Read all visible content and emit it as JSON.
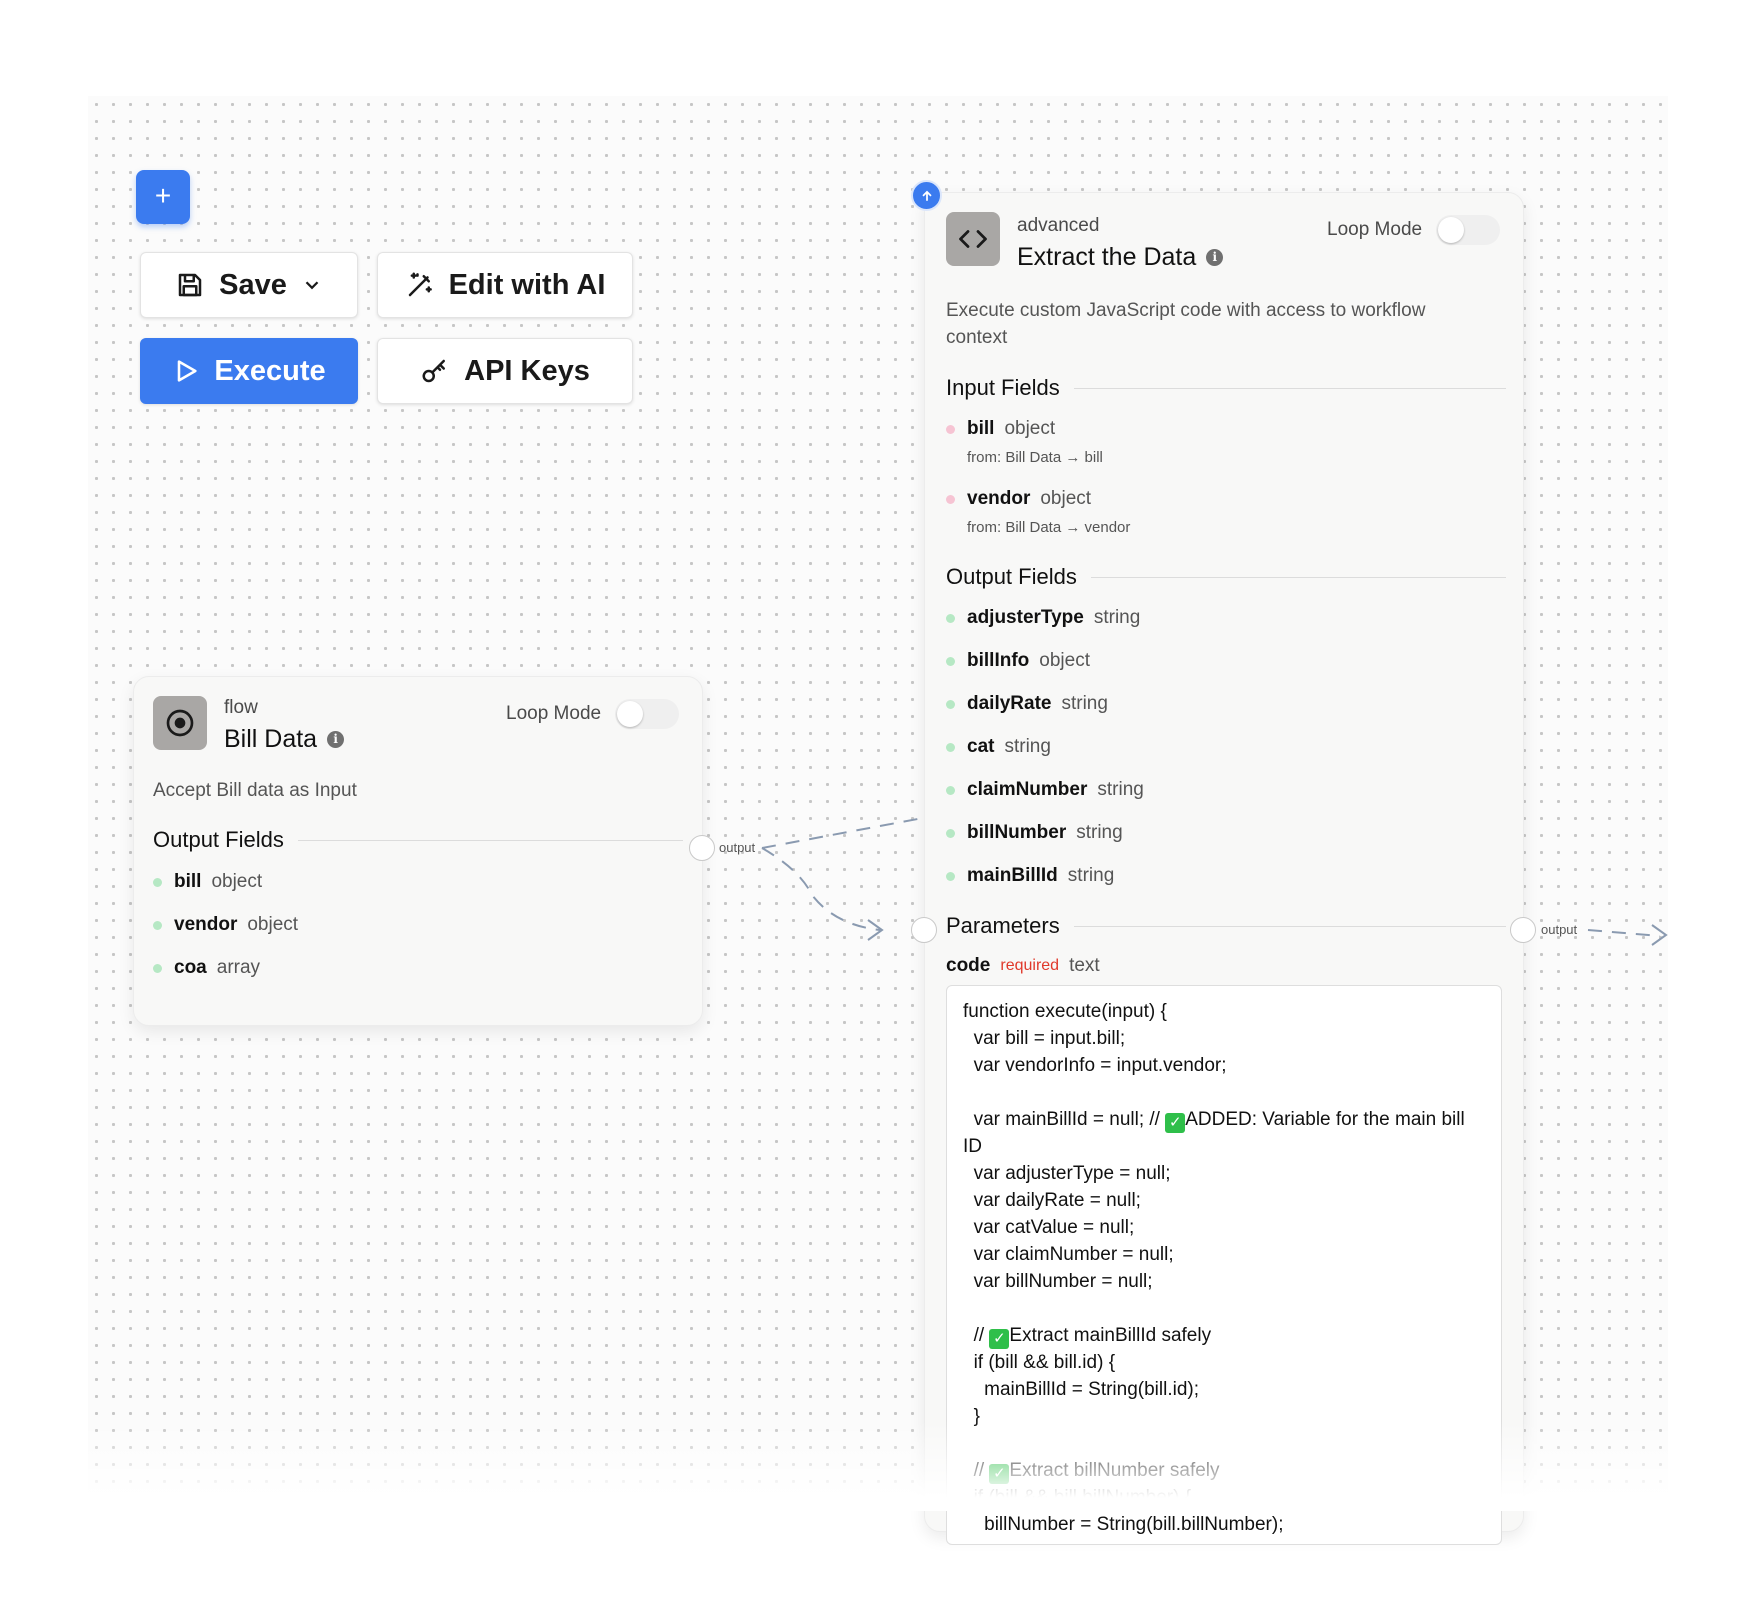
{
  "toolbar": {
    "add_label": "+",
    "save_label": "Save",
    "edit_ai_label": "Edit with AI",
    "execute_label": "Execute",
    "api_keys_label": "API Keys",
    "accent_color": "#3b7bef"
  },
  "bill_node": {
    "category": "flow",
    "title": "Bill Data",
    "info_icon": "i",
    "loop_mode_label": "Loop Mode",
    "loop_mode_on": false,
    "description": "Accept Bill data as Input",
    "output_section_title": "Output Fields",
    "outputs": [
      {
        "name": "bill",
        "type": "object"
      },
      {
        "name": "vendor",
        "type": "object"
      },
      {
        "name": "coa",
        "type": "array"
      }
    ],
    "output_port_label": "output"
  },
  "extract_node": {
    "category": "advanced",
    "title": "Extract the Data",
    "info_icon": "i",
    "loop_mode_label": "Loop Mode",
    "loop_mode_on": false,
    "description": "Execute custom JavaScript code with access to workflow context",
    "input_section_title": "Input Fields",
    "inputs": [
      {
        "name": "bill",
        "type": "object",
        "from": "from: Bill Data → bill"
      },
      {
        "name": "vendor",
        "type": "object",
        "from": "from: Bill Data → vendor"
      }
    ],
    "output_section_title": "Output Fields",
    "outputs": [
      {
        "name": "adjusterType",
        "type": "string"
      },
      {
        "name": "billInfo",
        "type": "object"
      },
      {
        "name": "dailyRate",
        "type": "string"
      },
      {
        "name": "cat",
        "type": "string"
      },
      {
        "name": "claimNumber",
        "type": "string"
      },
      {
        "name": "billNumber",
        "type": "string"
      },
      {
        "name": "mainBillId",
        "type": "string"
      }
    ],
    "parameters_title": "Parameters",
    "param_name": "code",
    "param_required": "required",
    "param_type": "text",
    "output_port_label": "output",
    "code_lines": [
      "function execute(input) {",
      "  var bill = input.bill;",
      "  var vendorInfo = input.vendor;",
      "",
      "  var mainBillId = null; // ✅ADDED: Variable for the main bill ID",
      "  var adjusterType = null;",
      "  var dailyRate = null;",
      "  var catValue = null;",
      "  var claimNumber = null;",
      "  var billNumber = null;",
      "",
      "  // ✅Extract mainBillId safely",
      "  if (bill && bill.id) {",
      "    mainBillId = String(bill.id);",
      "  }",
      "",
      "  // ✅Extract billNumber safely",
      "  if (bill && bill.billNumber) {",
      "    billNumber = String(bill.billNumber);"
    ]
  }
}
